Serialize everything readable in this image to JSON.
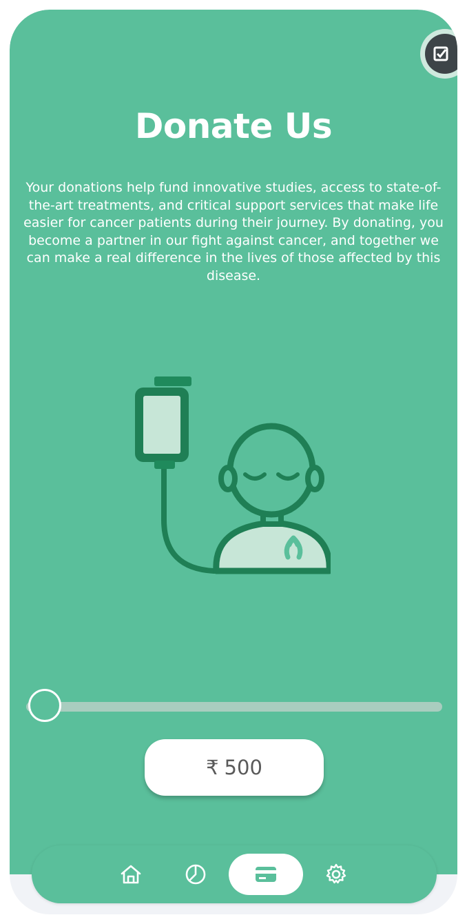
{
  "header": {
    "title": "Donate Us",
    "description": "Your donations help fund innovative studies, access to state-of-the-art treatments, and critical support services that make life easier for cancer patients during their journey. By donating, you become a partner in our fight against cancer, and together we can make a real difference in the lives of those affected by this disease."
  },
  "illustration": {
    "icon": "patient-iv-drip-icon"
  },
  "donation": {
    "slider_level": 0,
    "currency_symbol": "₹",
    "amount": "500"
  },
  "nav": {
    "items": [
      {
        "icon": "home-icon",
        "active": false
      },
      {
        "icon": "pie-chart-icon",
        "active": false
      },
      {
        "icon": "card-icon",
        "active": true
      },
      {
        "icon": "gear-icon",
        "active": false
      }
    ]
  },
  "colors": {
    "accent": "#5abf9b",
    "dark_green": "#1f7f55",
    "light_green": "#c7e6d7",
    "track": "#a9cdbf"
  }
}
